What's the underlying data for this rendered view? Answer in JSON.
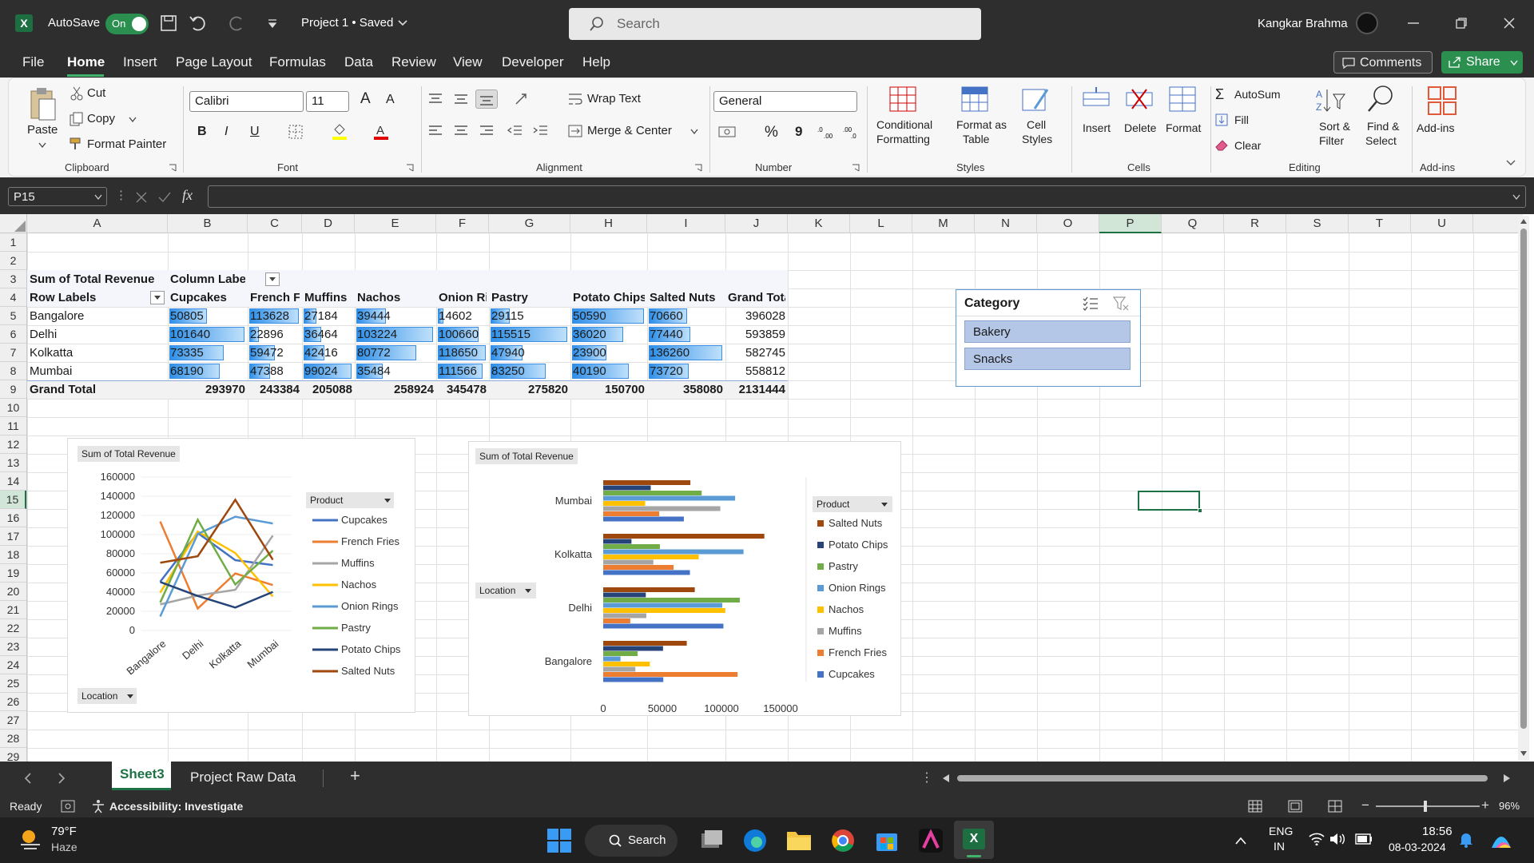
{
  "titlebar": {
    "app_letter": "X",
    "autosave_label": "AutoSave",
    "autosave_state": "On",
    "doc_title": "Project 1 • Saved",
    "search_placeholder": "Search",
    "user_name": "Kangkar Brahma"
  },
  "menu": [
    "File",
    "Home",
    "Insert",
    "Page Layout",
    "Formulas",
    "Data",
    "Review",
    "View",
    "Developer",
    "Help"
  ],
  "menu_right": {
    "comments": "Comments",
    "share": "Share"
  },
  "ribbon": {
    "clipboard": {
      "paste": "Paste",
      "cut": "Cut",
      "copy": "Copy",
      "format_painter": "Format Painter",
      "group": "Clipboard"
    },
    "font": {
      "name": "Calibri",
      "size": "11",
      "bold": "B",
      "italic": "I",
      "underline": "U",
      "grow": "A",
      "shrink": "A",
      "group": "Font"
    },
    "alignment": {
      "wrap": "Wrap Text",
      "merge": "Merge & Center",
      "group": "Alignment"
    },
    "number": {
      "format": "General",
      "percent": "%",
      "comma": "9",
      "group": "Number"
    },
    "styles": {
      "cond1": "Conditional",
      "cond2": "Formatting",
      "fmt1": "Format as",
      "fmt2": "Table",
      "cell1": "Cell",
      "cell2": "Styles",
      "group": "Styles"
    },
    "cells": {
      "insert": "Insert",
      "delete": "Delete",
      "format": "Format",
      "group": "Cells"
    },
    "editing": {
      "autosum": "AutoSum",
      "fill": "Fill",
      "clear": "Clear",
      "sort1": "Sort &",
      "sort2": "Filter",
      "find1": "Find &",
      "find2": "Select",
      "group": "Editing"
    },
    "addins": {
      "label": "Add-ins",
      "group": "Add-ins"
    }
  },
  "formula_bar": {
    "name_box": "P15",
    "fx": "fx",
    "content": ""
  },
  "columns": [
    "A",
    "B",
    "C",
    "D",
    "E",
    "F",
    "G",
    "H",
    "I",
    "J",
    "K",
    "L",
    "M",
    "N",
    "O",
    "P",
    "Q",
    "R",
    "S",
    "T",
    "U"
  ],
  "rows": [
    "1",
    "2",
    "3",
    "4",
    "5",
    "6",
    "7",
    "8",
    "9",
    "10",
    "11",
    "12",
    "13",
    "14",
    "15",
    "16",
    "17",
    "18",
    "19",
    "20",
    "21",
    "22",
    "23",
    "24",
    "25",
    "26",
    "27",
    "28",
    "29"
  ],
  "pivot": {
    "corner": "Sum of Total Revenue",
    "col_labels": "Column Labels",
    "row_labels": "Row Labels",
    "headers": [
      "Cupcakes",
      "French Fries",
      "Muffins",
      "Nachos",
      "Onion Rings",
      "Pastry",
      "Potato Chips",
      "Salted Nuts",
      "Grand Total"
    ],
    "rows": [
      {
        "label": "Bangalore",
        "values": [
          "50805",
          "113628",
          "27184",
          "39444",
          "14602",
          "29115",
          "50590",
          "70660",
          "396028"
        ]
      },
      {
        "label": "Delhi",
        "values": [
          "101640",
          "22896",
          "36464",
          "103224",
          "100660",
          "115515",
          "36020",
          "77440",
          "593859"
        ]
      },
      {
        "label": "Kolkatta",
        "values": [
          "73335",
          "59472",
          "42416",
          "80772",
          "118650",
          "47940",
          "23900",
          "136260",
          "582745"
        ]
      },
      {
        "label": "Mumbai",
        "values": [
          "68190",
          "47388",
          "99024",
          "35484",
          "111566",
          "83250",
          "40190",
          "73720",
          "558812"
        ]
      }
    ],
    "grand_total": {
      "label": "Grand Total",
      "values": [
        "293970",
        "243384",
        "205088",
        "258924",
        "345478",
        "275820",
        "150700",
        "358080",
        "2131444"
      ]
    }
  },
  "slicer": {
    "title": "Category",
    "items": [
      "Bakery",
      "Snacks"
    ]
  },
  "chart_data": [
    {
      "type": "line",
      "title": "Sum of Total Revenue",
      "categories": [
        "Bangalore",
        "Delhi",
        "Kolkatta",
        "Mumbai"
      ],
      "ylim": [
        0,
        160000
      ],
      "yticks": [
        "160000",
        "140000",
        "120000",
        "100000",
        "80000",
        "60000",
        "40000",
        "20000",
        "0"
      ],
      "legend_title": "Product",
      "axis_button": "Location",
      "series": [
        {
          "name": "Cupcakes",
          "color": "#4472c4",
          "values": [
            50805,
            101640,
            73335,
            68190
          ]
        },
        {
          "name": "French Fries",
          "color": "#ed7d31",
          "values": [
            113628,
            22896,
            59472,
            47388
          ]
        },
        {
          "name": "Muffins",
          "color": "#a5a5a5",
          "values": [
            27184,
            36464,
            42416,
            99024
          ]
        },
        {
          "name": "Nachos",
          "color": "#ffc000",
          "values": [
            39444,
            103224,
            80772,
            35484
          ]
        },
        {
          "name": "Onion Rings",
          "color": "#5b9bd5",
          "values": [
            14602,
            100660,
            118650,
            111566
          ]
        },
        {
          "name": "Pastry",
          "color": "#70ad47",
          "values": [
            29115,
            115515,
            47940,
            83250
          ]
        },
        {
          "name": "Potato Chips",
          "color": "#264478",
          "values": [
            50590,
            36020,
            23900,
            40190
          ]
        },
        {
          "name": "Salted Nuts",
          "color": "#9e480e",
          "values": [
            70660,
            77440,
            136260,
            73720
          ]
        }
      ]
    },
    {
      "type": "bar",
      "orientation": "horizontal",
      "title": "Sum of Total Revenue",
      "categories": [
        "Mumbai",
        "Kolkatta",
        "Delhi",
        "Bangalore"
      ],
      "xlim": [
        0,
        150000
      ],
      "xticks": [
        "0",
        "50000",
        "100000",
        "150000"
      ],
      "legend_title": "Product",
      "axis_button": "Location",
      "series": [
        {
          "name": "Salted Nuts",
          "color": "#9e480e",
          "values": [
            73720,
            136260,
            77440,
            70660
          ]
        },
        {
          "name": "Potato Chips",
          "color": "#264478",
          "values": [
            40190,
            23900,
            36020,
            50590
          ]
        },
        {
          "name": "Pastry",
          "color": "#70ad47",
          "values": [
            83250,
            47940,
            115515,
            29115
          ]
        },
        {
          "name": "Onion Rings",
          "color": "#5b9bd5",
          "values": [
            111566,
            118650,
            100660,
            14602
          ]
        },
        {
          "name": "Nachos",
          "color": "#ffc000",
          "values": [
            35484,
            80772,
            103224,
            39444
          ]
        },
        {
          "name": "Muffins",
          "color": "#a5a5a5",
          "values": [
            99024,
            42416,
            36464,
            27184
          ]
        },
        {
          "name": "French Fries",
          "color": "#ed7d31",
          "values": [
            47388,
            59472,
            22896,
            113628
          ]
        },
        {
          "name": "Cupcakes",
          "color": "#4472c4",
          "values": [
            68190,
            73335,
            101640,
            50805
          ]
        }
      ]
    }
  ],
  "sheets": [
    "Sheet3",
    "Project Raw Data"
  ],
  "status": {
    "ready": "Ready",
    "accessibility": "Accessibility: Investigate",
    "zoom": "96%"
  },
  "taskbar": {
    "temp": "79°F",
    "weather": "Haze",
    "search": "Search",
    "lang1": "ENG",
    "lang2": "IN",
    "time": "18:56",
    "date": "08-03-2024"
  }
}
